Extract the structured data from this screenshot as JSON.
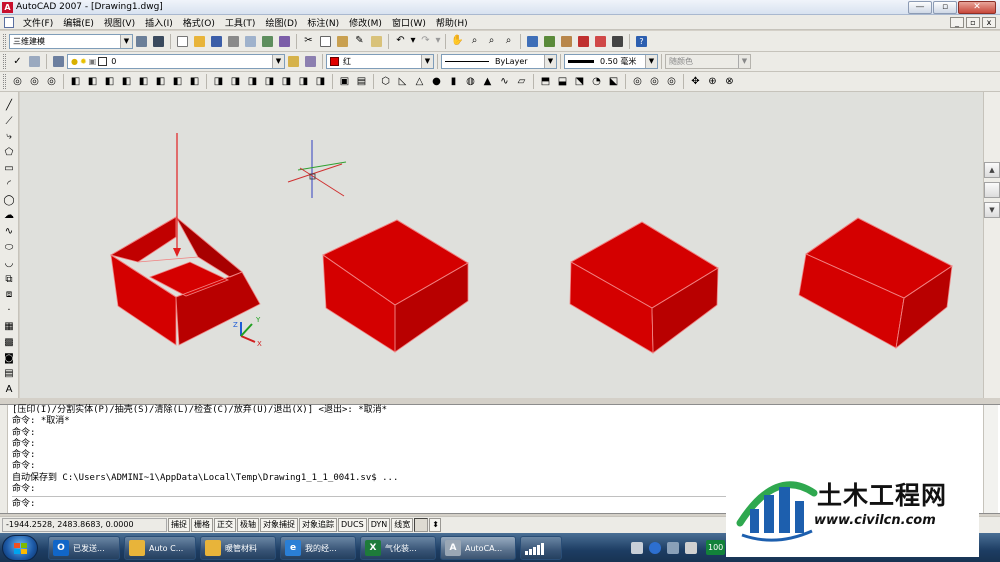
{
  "window": {
    "title": "AutoCAD 2007 - [Drawing1.dwg]",
    "buttons": {
      "minimize": "—",
      "restore": "▫",
      "close": "✕"
    }
  },
  "menu": [
    "文件(F)",
    "编辑(E)",
    "视图(V)",
    "插入(I)",
    "格式(O)",
    "工具(T)",
    "绘图(D)",
    "标注(N)",
    "修改(M)",
    "窗口(W)",
    "帮助(H)"
  ],
  "mdi_buttons": [
    "_",
    "▫",
    "x"
  ],
  "toolbar1": {
    "workspace": "三维建模"
  },
  "toolbar2": {
    "layer": "0",
    "color": "红",
    "color_hex": "#e00000",
    "linetype": "ByLayer",
    "lineweight": "0.50 毫米",
    "plotstyle": "随颜色"
  },
  "drawing": {
    "background": "#dfe0dc",
    "solid_color": "#d40000",
    "edge_color": "#f08080",
    "ucs_labels": {
      "x": "X",
      "y": "Y",
      "z": "Z"
    }
  },
  "command": {
    "history": [
      "[压印(I)/分割实体(P)/抽壳(S)/清除(L)/检查(C)/放弃(U)/退出(X)] <退出>: *取消*",
      "命令: *取消*",
      "命令:",
      "命令:",
      "命令:",
      "命令:",
      "自动保存到 C:\\Users\\ADMINI~1\\AppData\\Local\\Temp\\Drawing1_1_1_0041.sv$ ...",
      "命令:"
    ],
    "prompt": "命令:"
  },
  "status": {
    "coordinates": "-1944.2528, 2483.8683, 0.0000",
    "toggles": [
      {
        "label": "捕捉",
        "on": false
      },
      {
        "label": "栅格",
        "on": false
      },
      {
        "label": "正交",
        "on": false
      },
      {
        "label": "极轴",
        "on": false
      },
      {
        "label": "对象捕捉",
        "on": false
      },
      {
        "label": "对象追踪",
        "on": false
      },
      {
        "label": "DUCS",
        "on": false
      },
      {
        "label": "DYN",
        "on": false
      },
      {
        "label": "线宽",
        "on": false
      }
    ]
  },
  "taskbar": {
    "tasks": [
      {
        "label": "已发送...",
        "icon": "O",
        "color": "#1166c8"
      },
      {
        "label": "Auto C...",
        "icon": "",
        "color": "#e8b43a"
      },
      {
        "label": "暖管材料",
        "icon": "",
        "color": "#e8b43a"
      },
      {
        "label": "我的经...",
        "icon": "e",
        "color": "#2a7fd6"
      },
      {
        "label": "气化装...",
        "icon": "X",
        "color": "#1e7b3a"
      },
      {
        "label": "AutoCA...",
        "icon": "A",
        "color": "#9aa7b5"
      }
    ],
    "battery": "100"
  },
  "watermark": {
    "title": "土木工程网",
    "url": "www.civilcn.com"
  }
}
